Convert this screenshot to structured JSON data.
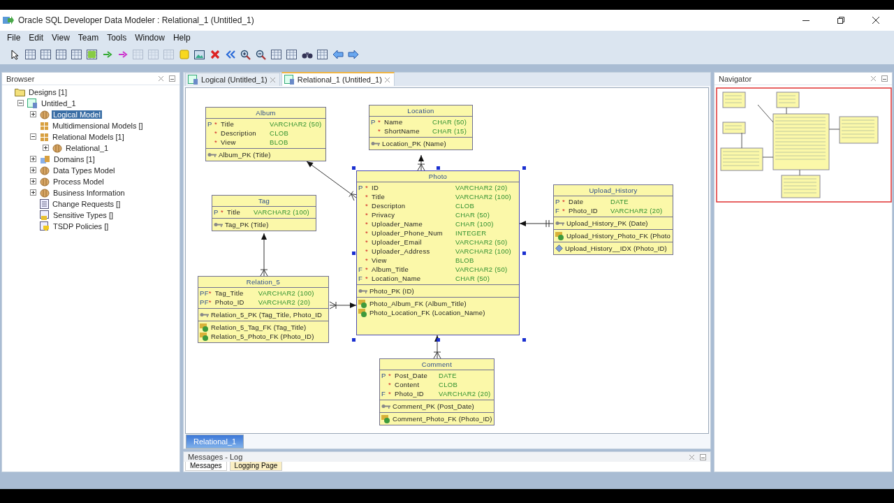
{
  "window": {
    "title": "Oracle SQL Developer Data Modeler : Relational_1 (Untitled_1)"
  },
  "menu": [
    "File",
    "Edit",
    "View",
    "Team",
    "Tools",
    "Window",
    "Help"
  ],
  "toolbar": [
    {
      "disabled": false
    },
    {
      "disabled": false
    },
    {
      "disabled": false
    },
    {
      "disabled": false
    },
    {
      "disabled": false
    },
    {
      "disabled": false
    },
    {
      "disabled": false
    },
    {
      "disabled": false
    },
    {
      "disabled": true
    },
    {
      "disabled": true
    },
    {
      "disabled": true
    },
    {
      "disabled": false
    },
    {
      "disabled": false
    },
    {
      "disabled": false
    },
    {
      "disabled": false
    },
    {
      "disabled": false
    },
    {
      "disabled": false
    },
    {
      "disabled": false
    },
    {
      "disabled": false
    },
    {
      "disabled": false
    },
    {
      "disabled": false
    },
    {
      "disabled": false
    },
    {
      "disabled": false
    }
  ],
  "browser": {
    "title": "Browser",
    "tree": [
      {
        "label": "Designs [1]",
        "kind": "folder",
        "selected": false,
        "children": [
          {
            "label": "Untitled_1",
            "kind": "design",
            "selected": false,
            "expanded": true,
            "children": [
              {
                "label": "Logical Model",
                "kind": "model",
                "selected": true,
                "expanded": false
              },
              {
                "label": "Multidimensional Models []",
                "kind": "grid",
                "selected": false
              },
              {
                "label": "Relational Models [1]",
                "kind": "grid",
                "selected": false,
                "expanded": true,
                "children": [
                  {
                    "label": "Relational_1",
                    "kind": "model",
                    "selected": false,
                    "expanded": false
                  }
                ]
              },
              {
                "label": "Domains [1]",
                "kind": "domain",
                "selected": false,
                "expanded": false
              },
              {
                "label": "Data Types Model",
                "kind": "model",
                "selected": false,
                "expanded": false
              },
              {
                "label": "Process Model",
                "kind": "model",
                "selected": false,
                "expanded": false
              },
              {
                "label": "Business Information",
                "kind": "model",
                "selected": false,
                "expanded": false
              },
              {
                "label": "Change Requests []",
                "kind": "list",
                "selected": false
              },
              {
                "label": "Sensitive Types []",
                "kind": "sensitive",
                "selected": false
              },
              {
                "label": "TSDP Policies []",
                "kind": "policy",
                "selected": false
              }
            ]
          }
        ]
      }
    ]
  },
  "editor": {
    "tabs": [
      {
        "label": "Logical (Untitled_1)",
        "selected": false
      },
      {
        "label": "Relational_1 (Untitled_1)",
        "selected": true
      }
    ],
    "diagram_tabs": [
      {
        "label": "Relational_1",
        "selected": true
      }
    ],
    "tables": [
      {
        "name": "Album",
        "selected": false,
        "columns": [
          {
            "flag": "P",
            "mark": "*",
            "name": "Title",
            "type": "VARCHAR2 (50)"
          },
          {
            "mark": "*",
            "name": "Description",
            "type": "CLOB"
          },
          {
            "mark": "*",
            "name": "View",
            "type": "BLOB"
          }
        ],
        "keys": [
          {
            "kind": "pk",
            "label": "Album_PK (Title)"
          }
        ]
      },
      {
        "name": "Location",
        "selected": false,
        "columns": [
          {
            "flag": "P",
            "mark": "*",
            "name": "Name",
            "type": "CHAR (50)"
          },
          {
            "mark": "*",
            "name": "ShortName",
            "type": "CHAR (15)"
          }
        ],
        "keys": [
          {
            "kind": "pk",
            "label": "Location_PK (Name)"
          }
        ]
      },
      {
        "name": "Photo",
        "selected": true,
        "columns": [
          {
            "flag": "P",
            "mark": "*",
            "name": "ID",
            "type": "VARCHAR2 (20)"
          },
          {
            "mark": "*",
            "name": "Title",
            "type": "VARCHAR2 (100)"
          },
          {
            "mark": "*",
            "name": "Descripton",
            "type": "CLOB"
          },
          {
            "mark": "*",
            "name": "Privacy",
            "type": "CHAR (50)"
          },
          {
            "mark": "*",
            "name": "Uploader_Name",
            "type": "CHAR (100)"
          },
          {
            "mark": "*",
            "name": "Uploader_Phone_Num",
            "type": "INTEGER"
          },
          {
            "mark": "*",
            "name": "Uploader_Email",
            "type": "VARCHAR2 (50)"
          },
          {
            "mark": "*",
            "name": "Uploader_Address",
            "type": "VARCHAR2 (100)"
          },
          {
            "mark": "*",
            "name": "View",
            "type": "BLOB"
          },
          {
            "flag": "F",
            "mark": "*",
            "name": "Album_Title",
            "type": "VARCHAR2 (50)"
          },
          {
            "flag": "F",
            "mark": "*",
            "name": "Location_Name",
            "type": "CHAR (50)"
          }
        ],
        "keys": [
          {
            "kind": "pk",
            "label": "Photo_PK (ID)"
          },
          {
            "kind": "fk",
            "label": "Photo_Album_FK (Album_Title)"
          },
          {
            "kind": "fk",
            "label": "Photo_Location_FK (Location_Name)"
          }
        ]
      },
      {
        "name": "Tag",
        "selected": false,
        "columns": [
          {
            "flag": "P",
            "mark": "*",
            "name": "Title",
            "type": "VARCHAR2 (100)"
          }
        ],
        "keys": [
          {
            "kind": "pk",
            "label": "Tag_PK (Title)"
          }
        ]
      },
      {
        "name": "Relation_5",
        "selected": false,
        "columns": [
          {
            "flag": "PF",
            "mark": "*",
            "name": "Tag_Title",
            "type": "VARCHAR2 (100)"
          },
          {
            "flag": "PF",
            "mark": "*",
            "name": "Photo_ID",
            "type": "VARCHAR2 (20)"
          }
        ],
        "keys": [
          {
            "kind": "pk",
            "label": "Relation_5_PK (Tag_Title, Photo_ID"
          },
          {
            "kind": "fk",
            "label": "Relation_5_Tag_FK (Tag_Title)"
          },
          {
            "kind": "fk",
            "label": "Relation_5_Photo_FK (Photo_ID)"
          }
        ]
      },
      {
        "name": "Upload_History",
        "selected": false,
        "columns": [
          {
            "flag": "P",
            "mark": "*",
            "name": "Date",
            "type": "DATE"
          },
          {
            "flag": "F",
            "mark": "*",
            "name": "Photo_ID",
            "type": "VARCHAR2 (20)"
          }
        ],
        "keys": [
          {
            "kind": "pk",
            "label": "Upload_History_PK (Date)"
          },
          {
            "kind": "fk",
            "label": "Upload_History_Photo_FK (Photo"
          },
          {
            "kind": "index",
            "label": "Upload_History__IDX (Photo_ID)"
          }
        ]
      },
      {
        "name": "Comment",
        "selected": false,
        "columns": [
          {
            "flag": "P",
            "mark": "*",
            "name": "Post_Date",
            "type": "DATE"
          },
          {
            "mark": "*",
            "name": "Content",
            "type": "CLOB"
          },
          {
            "flag": "F",
            "mark": "*",
            "name": "Photo_ID",
            "type": "VARCHAR2 (20)"
          }
        ],
        "keys": [
          {
            "kind": "pk",
            "label": "Comment_PK (Post_Date)"
          },
          {
            "kind": "fk",
            "label": "Comment_Photo_FK (Photo_ID)"
          }
        ]
      }
    ]
  },
  "navigator": {
    "title": "Navigator"
  },
  "messages": {
    "title": "Messages - Log",
    "tabs": [
      {
        "label": "Messages",
        "selected": true
      },
      {
        "label": "Logging Page",
        "selected": false
      }
    ]
  }
}
